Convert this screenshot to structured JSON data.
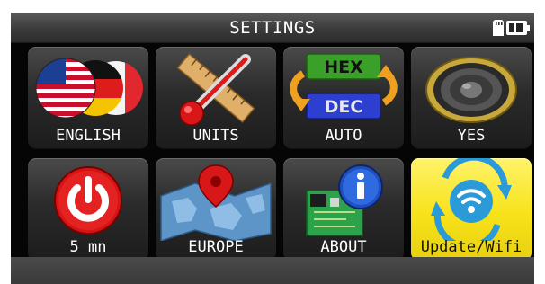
{
  "header": {
    "title": "SETTINGS",
    "icons": [
      "sd-card-icon",
      "battery-icon"
    ]
  },
  "tiles": [
    {
      "label": "ENGLISH",
      "icon": "flags-language-icon",
      "selected": false
    },
    {
      "label": "UNITS",
      "icon": "ruler-thermometer-icon",
      "selected": false
    },
    {
      "label": "AUTO",
      "icon": "hex-dec-icon",
      "selected": false,
      "hex_text": "HEX",
      "dec_text": "DEC"
    },
    {
      "label": "YES",
      "icon": "speaker-icon",
      "selected": false
    },
    {
      "label": "5 mn",
      "icon": "power-icon",
      "selected": false
    },
    {
      "label": "EUROPE",
      "icon": "map-pin-icon",
      "selected": false
    },
    {
      "label": "ABOUT",
      "icon": "info-board-icon",
      "selected": false
    },
    {
      "label": "Update/Wifi",
      "icon": "wifi-update-icon",
      "selected": true
    }
  ],
  "colors": {
    "screen_bg": "#050505",
    "tile_bg": "#2b2b2b",
    "selected_bg": "#f7e21a",
    "label_text": "#ffffff"
  }
}
